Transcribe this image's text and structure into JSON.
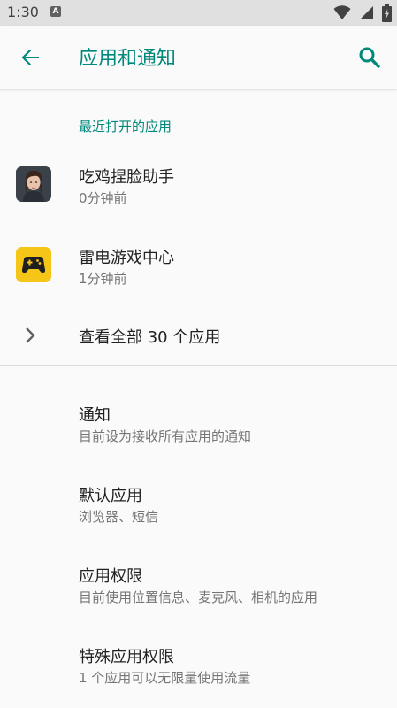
{
  "status_bar": {
    "time": "1:30",
    "notification_badge": "A",
    "icons": [
      "wifi-icon",
      "cell-signal-icon",
      "battery-icon"
    ]
  },
  "app_bar": {
    "title": "应用和通知",
    "back_icon": "arrow-back-icon",
    "search_icon": "search-icon"
  },
  "recent_apps": {
    "header": "最近打开的应用",
    "items": [
      {
        "name": "吃鸡捏脸助手",
        "time": "0分钟前",
        "icon": "face-avatar-icon"
      },
      {
        "name": "雷电游戏中心",
        "time": "1分钟前",
        "icon": "gamepad-icon"
      }
    ],
    "see_all": "查看全部 30 个应用"
  },
  "preferences": [
    {
      "title": "通知",
      "summary": "目前设为接收所有应用的通知"
    },
    {
      "title": "默认应用",
      "summary": "浏览器、短信"
    },
    {
      "title": "应用权限",
      "summary": "目前使用位置信息、麦克风、相机的应用"
    },
    {
      "title": "特殊应用权限",
      "summary": "1 个应用可以无限量使用流量"
    }
  ],
  "colors": {
    "accent": "#00897b",
    "background": "#fafafa",
    "status_bar": "#e0e0e0",
    "gamepad_yellow": "#f5c518"
  }
}
